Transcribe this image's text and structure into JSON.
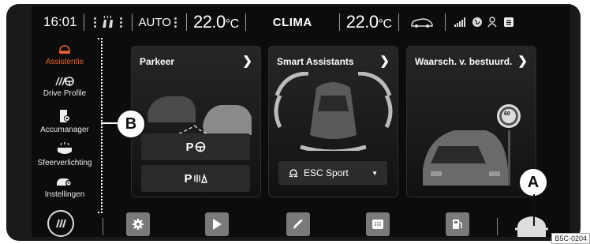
{
  "status_bar": {
    "time": "16:01",
    "auto_label": "AUTO",
    "temp_left_value": "22.0",
    "temp_left_unit": "°C",
    "clima_label": "CLIMA",
    "temp_right_value": "22.0",
    "temp_right_unit": "°C"
  },
  "sidebar": {
    "items": [
      {
        "label": "Assistentie",
        "icon": "driver-assist-icon",
        "active": true
      },
      {
        "label": "Drive Profile",
        "icon": "drive-profile-icon",
        "active": false
      },
      {
        "label": "Accumanager",
        "icon": "battery-manager-icon",
        "active": false
      },
      {
        "label": "Sfeerverlichting",
        "icon": "ambient-light-icon",
        "active": false
      },
      {
        "label": "Instellingen",
        "icon": "car-settings-icon",
        "active": false
      }
    ]
  },
  "cards": {
    "parking": {
      "title": "Parkeer",
      "button_assist": "P",
      "button_sensor": "P"
    },
    "assistants": {
      "title": "Smart Assistants",
      "dropdown_value": "ESC Sport"
    },
    "warnings": {
      "title": "Waarsch. v. bestuurd.",
      "speed_sign": "60"
    }
  },
  "bottom_bar": {
    "items": [
      "home-icon",
      "settings-icon",
      "media-icon",
      "phone-icon",
      "app-connect-icon",
      "fuel-icon",
      "car-icon"
    ]
  },
  "callouts": {
    "a": "A",
    "b": "B"
  },
  "image_code": "B5C-0204",
  "colors": {
    "accent": "#e8642f",
    "background": "#0c0c0c",
    "button": "#7a7a7a"
  }
}
